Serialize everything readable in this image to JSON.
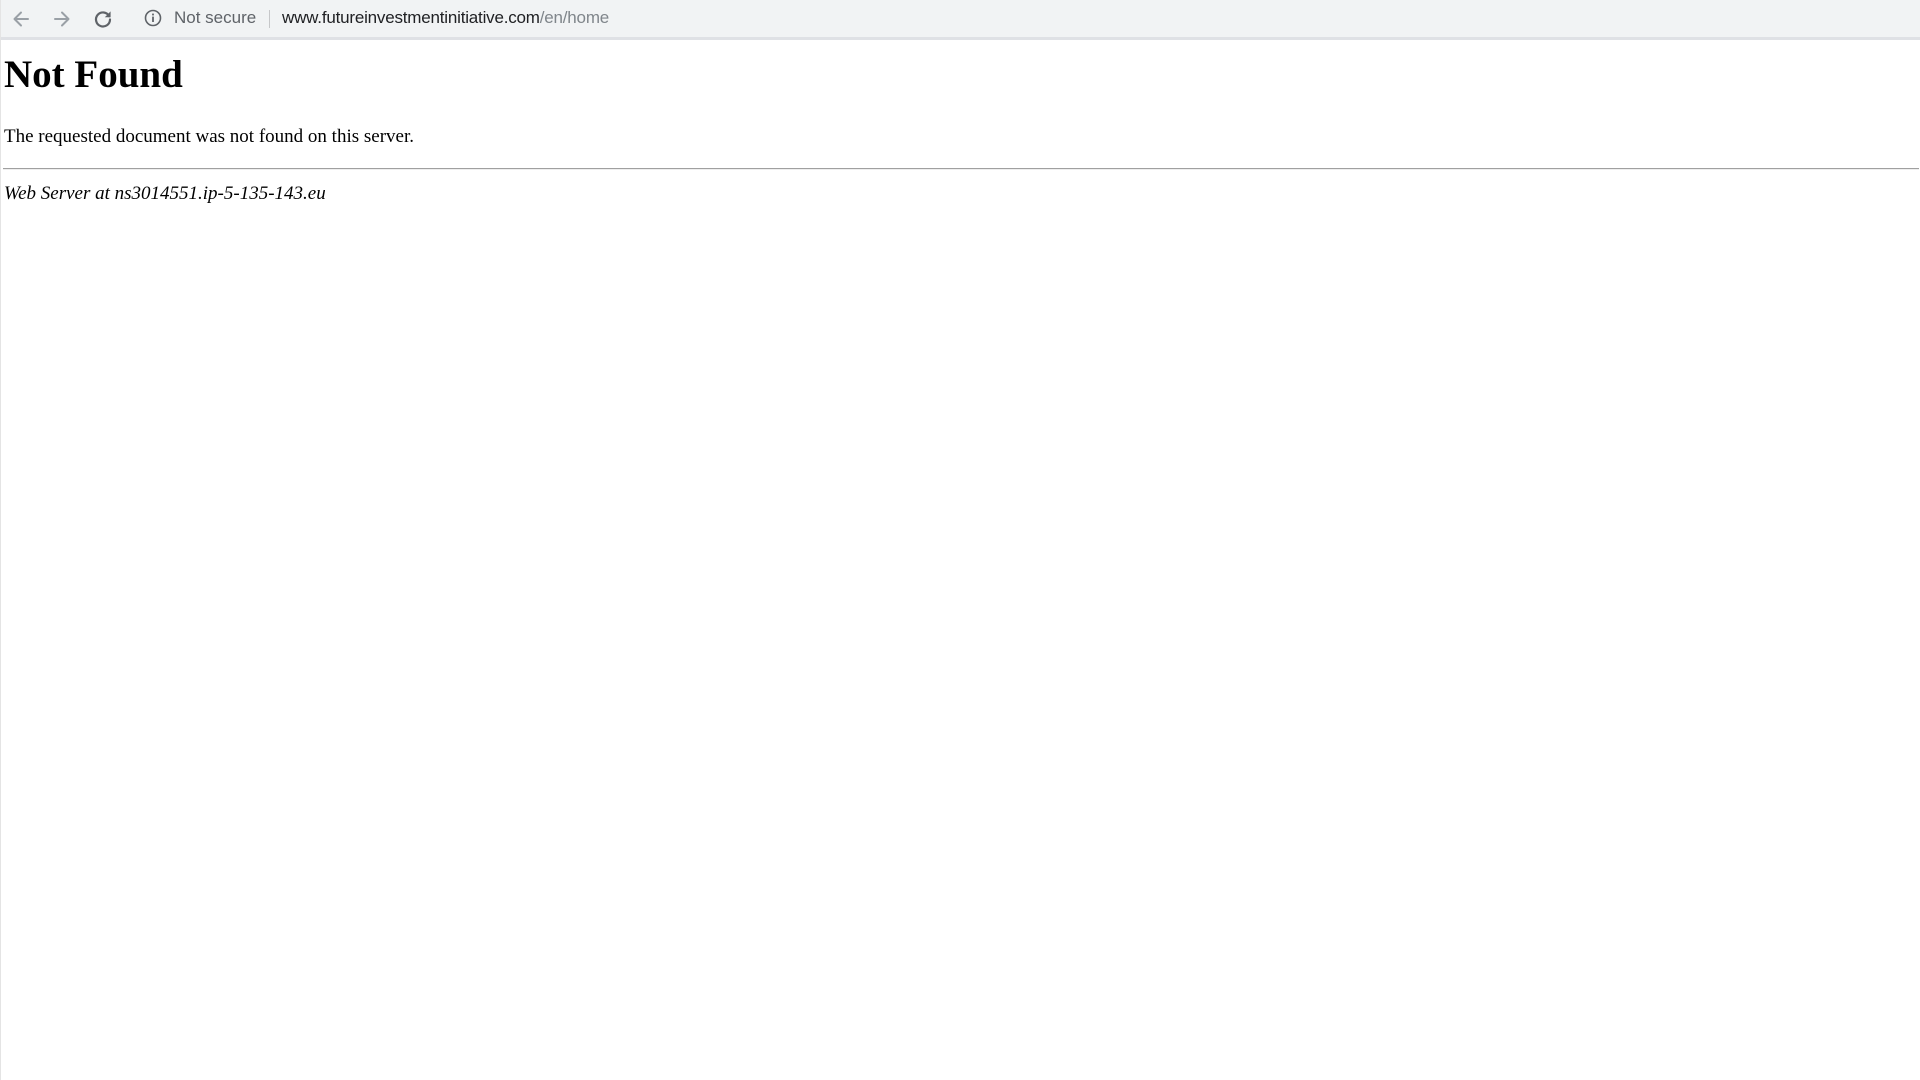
{
  "browser": {
    "security_label": "Not secure",
    "url_host": "www.futureinvestmentinitiative.com",
    "url_path": "/en/home",
    "icons": {
      "back": "arrow-left",
      "forward": "arrow-right",
      "reload": "reload",
      "security": "info-circle"
    },
    "colors": {
      "toolbar_bg": "#f1f3f4",
      "icon": "#5f6368",
      "icon_disabled": "#9aa0a6",
      "url_host": "#202124",
      "url_path": "#80868b"
    }
  },
  "page": {
    "title": "Not Found",
    "message": "The requested document was not found on this server.",
    "signature": "Web Server at ns3014551.ip-5-135-143.eu"
  }
}
